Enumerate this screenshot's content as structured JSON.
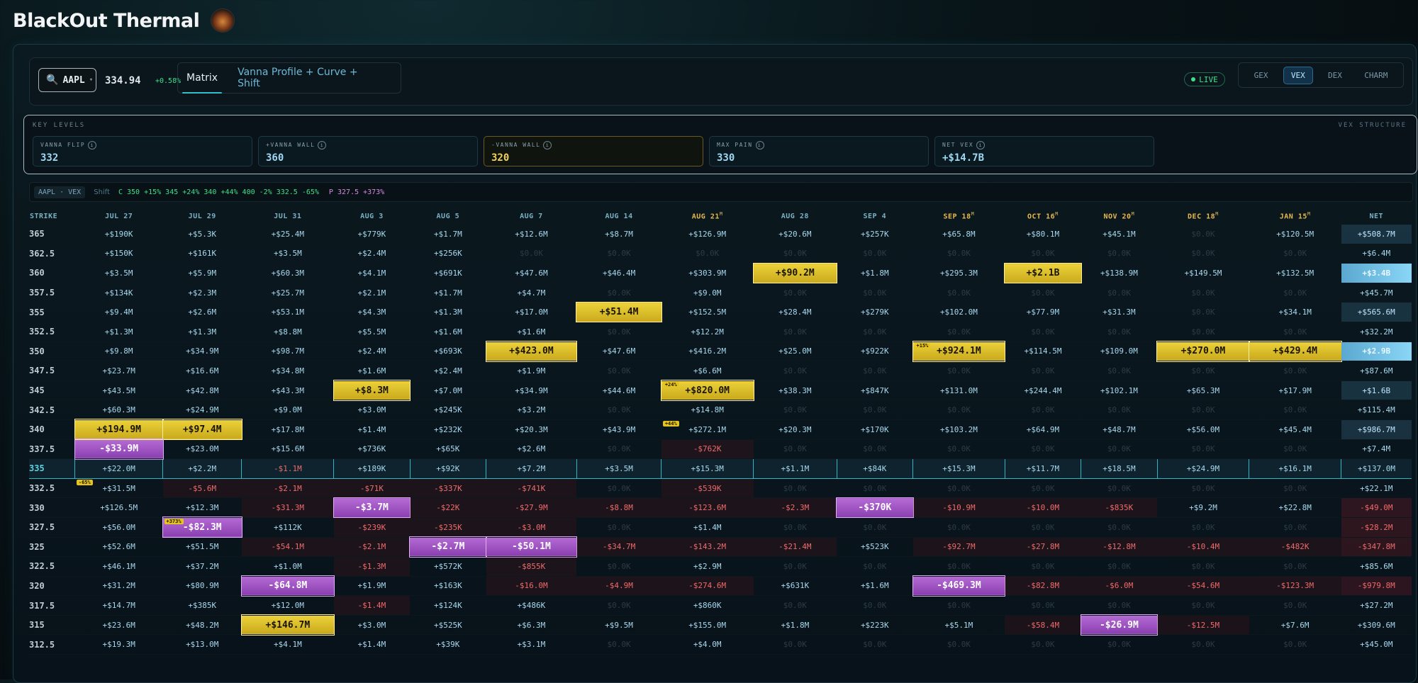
{
  "app": {
    "title": "BlackOut Thermal",
    "logo_icon": "thermal-logo-icon"
  },
  "toolbar": {
    "ticker": "AAPL",
    "price": "334.94",
    "change": "+0.58%",
    "tabs": [
      {
        "label": "Matrix",
        "active": true
      },
      {
        "label": "Vanna Profile + Curve + Shift",
        "active": false
      }
    ],
    "live_label": "LIVE",
    "greeks": [
      {
        "label": "GEX",
        "active": false
      },
      {
        "label": "VEX",
        "active": true
      },
      {
        "label": "DEX",
        "active": false
      },
      {
        "label": "CHARM",
        "active": false
      }
    ]
  },
  "key_levels": {
    "title": "KEY LEVELS",
    "structure_label": "VEX STRUCTURE",
    "cards": [
      {
        "label": "VANNA FLIP",
        "value": "332"
      },
      {
        "label": "+VANNA WALL",
        "value": "360"
      },
      {
        "label": "-VANNA WALL",
        "value": "320"
      },
      {
        "label": "MAX PAIN",
        "value": "330"
      },
      {
        "label": "NET VEX",
        "value": "+$14.7B"
      }
    ]
  },
  "shift": {
    "badge": "AAPL · VEX",
    "label": "Shift",
    "calls": "C 350 +15% 345 +24% 340 +44% 400 -2% 332.5 -65%",
    "puts": "P 327.5 +373%"
  },
  "matrix": {
    "headers": [
      "STRIKE",
      "JUL 27",
      "JUL 29",
      "JUL 31",
      "AUG 3",
      "AUG 5",
      "AUG 7",
      "AUG 14",
      "AUG 21",
      "AUG 28",
      "SEP 4",
      "SEP 18",
      "OCT 16",
      "NOV 20",
      "DEC 18",
      "JAN 15",
      "NET"
    ],
    "header_monthly": [
      false,
      false,
      false,
      false,
      false,
      false,
      false,
      false,
      true,
      false,
      false,
      true,
      true,
      true,
      true,
      true,
      false
    ],
    "spot_strike": "335",
    "rows": [
      {
        "strike": "365",
        "cells": [
          "+$190K",
          "+$5.3K",
          "+$25.4M",
          "+$779K",
          "+$1.7M",
          "+$12.6M",
          "+$8.7M",
          "+$126.9M",
          "+$20.6M",
          "+$257K",
          "+$65.8M",
          "+$80.1M",
          "+$45.1M",
          "$0.0K",
          "+$120.5M",
          "+$508.7M"
        ]
      },
      {
        "strike": "362.5",
        "cells": [
          "+$150K",
          "+$161K",
          "+$3.5M",
          "+$2.4M",
          "+$256K",
          "$0.0K",
          "$0.0K",
          "$0.0K",
          "$0.0K",
          "$0.0K",
          "$0.0K",
          "$0.0K",
          "$0.0K",
          "$0.0K",
          "$0.0K",
          "+$6.4M"
        ]
      },
      {
        "strike": "360",
        "cells": [
          "+$3.5M",
          "+$5.9M",
          "+$60.3M",
          "+$4.1M",
          "+$691K",
          "+$47.6M",
          "+$46.4M",
          "+$303.9M",
          "+$90.2M",
          "+$1.8M",
          "+$295.3M",
          "+$2.1B",
          "+$138.9M",
          "+$149.5M",
          "+$132.5M",
          "+$3.4B"
        ]
      },
      {
        "strike": "357.5",
        "cells": [
          "+$134K",
          "+$2.3M",
          "+$25.7M",
          "+$2.1M",
          "+$1.7M",
          "+$4.7M",
          "$0.0K",
          "+$9.0M",
          "$0.0K",
          "$0.0K",
          "$0.0K",
          "$0.0K",
          "$0.0K",
          "$0.0K",
          "$0.0K",
          "+$45.7M"
        ]
      },
      {
        "strike": "355",
        "cells": [
          "+$9.4M",
          "+$2.6M",
          "+$53.1M",
          "+$4.3M",
          "+$1.3M",
          "+$17.0M",
          "+$51.4M",
          "+$152.5M",
          "+$28.4M",
          "+$279K",
          "+$102.0M",
          "+$77.9M",
          "+$31.3M",
          "$0.0K",
          "+$34.1M",
          "+$565.6M"
        ]
      },
      {
        "strike": "352.5",
        "cells": [
          "+$1.3M",
          "+$1.3M",
          "+$8.8M",
          "+$5.5M",
          "+$1.6M",
          "+$1.6M",
          "$0.0K",
          "+$12.2M",
          "$0.0K",
          "$0.0K",
          "$0.0K",
          "$0.0K",
          "$0.0K",
          "$0.0K",
          "$0.0K",
          "+$32.2M"
        ]
      },
      {
        "strike": "350",
        "cells": [
          "+$9.8M",
          "+$34.9M",
          "+$98.7M",
          "+$2.4M",
          "+$693K",
          "+$423.0M",
          "+$47.6M",
          "+$416.2M",
          "+$25.0M",
          "+$922K",
          "+$924.1M",
          "+$114.5M",
          "+$109.0M",
          "+$270.0M",
          "+$429.4M",
          "+$2.9B"
        ]
      },
      {
        "strike": "347.5",
        "cells": [
          "+$23.7M",
          "+$16.6M",
          "+$34.8M",
          "+$1.6M",
          "+$2.4M",
          "+$1.9M",
          "$0.0K",
          "+$6.6M",
          "$0.0K",
          "$0.0K",
          "$0.0K",
          "$0.0K",
          "$0.0K",
          "$0.0K",
          "$0.0K",
          "+$87.6M"
        ]
      },
      {
        "strike": "345",
        "cells": [
          "+$43.5M",
          "+$42.8M",
          "+$43.3M",
          "+$8.3M",
          "+$7.0M",
          "+$34.9M",
          "+$44.6M",
          "+$820.0M",
          "+$38.3M",
          "+$847K",
          "+$131.0M",
          "+$244.4M",
          "+$102.1M",
          "+$65.3M",
          "+$17.9M",
          "+$1.6B"
        ]
      },
      {
        "strike": "342.5",
        "cells": [
          "+$60.3M",
          "+$24.9M",
          "+$9.0M",
          "+$3.0M",
          "+$245K",
          "+$3.2M",
          "$0.0K",
          "+$14.8M",
          "$0.0K",
          "$0.0K",
          "$0.0K",
          "$0.0K",
          "$0.0K",
          "$0.0K",
          "$0.0K",
          "+$115.4M"
        ]
      },
      {
        "strike": "340",
        "cells": [
          "+$194.9M",
          "+$97.4M",
          "+$17.8M",
          "+$1.4M",
          "+$232K",
          "+$20.3M",
          "+$43.9M",
          "+$272.1M",
          "+$20.3M",
          "+$170K",
          "+$103.2M",
          "+$64.9M",
          "+$48.7M",
          "+$56.0M",
          "+$45.4M",
          "+$986.7M"
        ]
      },
      {
        "strike": "337.5",
        "cells": [
          "-$33.9M",
          "+$23.0M",
          "+$15.6M",
          "+$736K",
          "+$65K",
          "+$2.6M",
          "$0.0K",
          "-$762K",
          "$0.0K",
          "$0.0K",
          "$0.0K",
          "$0.0K",
          "$0.0K",
          "$0.0K",
          "$0.0K",
          "+$7.4M"
        ]
      },
      {
        "strike": "335",
        "cells": [
          "+$22.0M",
          "+$2.2M",
          "-$1.1M",
          "+$189K",
          "+$92K",
          "+$7.2M",
          "+$3.5M",
          "+$15.3M",
          "+$1.1M",
          "+$84K",
          "+$15.3M",
          "+$11.7M",
          "+$18.5M",
          "+$24.9M",
          "+$16.1M",
          "+$137.0M"
        ]
      },
      {
        "strike": "332.5",
        "cells": [
          "+$31.5M",
          "-$5.6M",
          "-$2.1M",
          "-$71K",
          "-$337K",
          "-$741K",
          "$0.0K",
          "-$539K",
          "$0.0K",
          "$0.0K",
          "$0.0K",
          "$0.0K",
          "$0.0K",
          "$0.0K",
          "$0.0K",
          "+$22.1M"
        ]
      },
      {
        "strike": "330",
        "cells": [
          "+$126.5M",
          "+$12.3M",
          "-$31.3M",
          "-$3.7M",
          "-$22K",
          "-$27.9M",
          "-$8.8M",
          "-$123.6M",
          "-$2.3M",
          "-$370K",
          "-$10.9M",
          "-$10.0M",
          "-$835K",
          "+$9.2M",
          "+$22.8M",
          "-$49.0M"
        ]
      },
      {
        "strike": "327.5",
        "cells": [
          "+$56.0M",
          "-$82.3M",
          "+$112K",
          "-$239K",
          "-$235K",
          "-$3.0M",
          "$0.0K",
          "+$1.4M",
          "$0.0K",
          "$0.0K",
          "$0.0K",
          "$0.0K",
          "$0.0K",
          "$0.0K",
          "$0.0K",
          "-$28.2M"
        ]
      },
      {
        "strike": "325",
        "cells": [
          "+$52.6M",
          "+$51.5M",
          "-$54.1M",
          "-$2.1M",
          "-$2.7M",
          "-$50.1M",
          "-$34.7M",
          "-$143.2M",
          "-$21.4M",
          "+$523K",
          "-$92.7M",
          "-$27.8M",
          "-$12.8M",
          "-$10.4M",
          "-$482K",
          "-$347.8M"
        ]
      },
      {
        "strike": "322.5",
        "cells": [
          "+$46.1M",
          "+$37.2M",
          "+$1.0M",
          "-$1.3M",
          "+$572K",
          "-$855K",
          "$0.0K",
          "+$2.9M",
          "$0.0K",
          "$0.0K",
          "$0.0K",
          "$0.0K",
          "$0.0K",
          "$0.0K",
          "$0.0K",
          "+$85.6M"
        ]
      },
      {
        "strike": "320",
        "cells": [
          "+$31.2M",
          "+$80.9M",
          "-$64.8M",
          "+$1.9M",
          "+$163K",
          "-$16.0M",
          "-$4.9M",
          "-$274.6M",
          "+$631K",
          "+$1.6M",
          "-$469.3M",
          "-$82.8M",
          "-$6.0M",
          "-$54.6M",
          "-$123.3M",
          "-$979.8M"
        ]
      },
      {
        "strike": "317.5",
        "cells": [
          "+$14.7M",
          "+$385K",
          "+$12.0M",
          "-$1.4M",
          "+$124K",
          "+$486K",
          "$0.0K",
          "+$860K",
          "$0.0K",
          "$0.0K",
          "$0.0K",
          "$0.0K",
          "$0.0K",
          "$0.0K",
          "$0.0K",
          "+$27.2M"
        ]
      },
      {
        "strike": "315",
        "cells": [
          "+$23.6M",
          "+$48.2M",
          "+$146.7M",
          "+$3.0M",
          "+$525K",
          "+$6.3M",
          "+$9.5M",
          "+$155.0M",
          "+$1.8M",
          "+$223K",
          "+$5.1M",
          "-$58.4M",
          "-$26.9M",
          "-$12.5M",
          "+$7.6M",
          "+$309.6M"
        ]
      },
      {
        "strike": "312.5",
        "cells": [
          "+$19.3M",
          "+$13.0M",
          "+$4.1M",
          "+$1.4M",
          "+$39K",
          "+$3.1M",
          "$0.0K",
          "+$4.0M",
          "$0.0K",
          "$0.0K",
          "$0.0K",
          "$0.0K",
          "$0.0K",
          "$0.0K",
          "$0.0K",
          "+$45.0M"
        ]
      }
    ],
    "highlights_gold": [
      [
        2,
        8
      ],
      [
        2,
        11
      ],
      [
        4,
        6
      ],
      [
        6,
        5
      ],
      [
        6,
        10
      ],
      [
        6,
        13
      ],
      [
        6,
        14
      ],
      [
        8,
        3
      ],
      [
        8,
        7
      ],
      [
        10,
        0
      ],
      [
        10,
        1
      ],
      [
        20,
        2
      ]
    ],
    "highlights_purple": [
      [
        11,
        0
      ],
      [
        14,
        3
      ],
      [
        14,
        9
      ],
      [
        15,
        1
      ],
      [
        16,
        4
      ],
      [
        16,
        5
      ],
      [
        18,
        2
      ],
      [
        18,
        10
      ],
      [
        20,
        12
      ]
    ],
    "badges": [
      {
        "row": 6,
        "col": 10,
        "text": "+15%"
      },
      {
        "row": 8,
        "col": 7,
        "text": "+24%"
      },
      {
        "row": 10,
        "col": 7,
        "text": "+44%"
      },
      {
        "row": 13,
        "col": 0,
        "text": "-65%"
      },
      {
        "row": 15,
        "col": 1,
        "text": "+373%"
      }
    ],
    "net_strong_rows": [
      2,
      6
    ],
    "net_medium_rows": [
      0,
      4,
      8,
      10
    ]
  }
}
